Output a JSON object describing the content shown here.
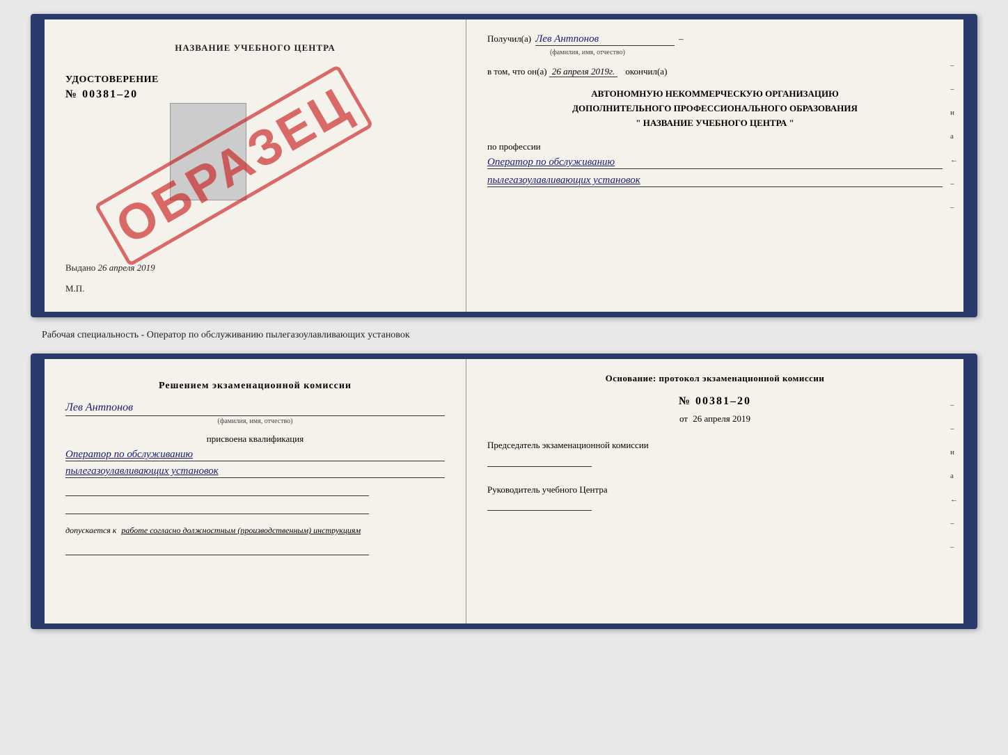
{
  "top_doc": {
    "left": {
      "center_title": "НАЗВАНИЕ УЧЕБНОГО ЦЕНТРА",
      "udostoverenie": "УДОСТОВЕРЕНИЕ",
      "number": "№ 00381–20",
      "vydano_prefix": "Выдано",
      "vydano_date": "26 апреля 2019",
      "mp": "М.П.",
      "obrazec": "ОБРАЗЕЦ"
    },
    "right": {
      "poluchil_prefix": "Получил(а)",
      "recipient_name": "Лев Антпонов",
      "fio_sub": "(фамилия, имя, отчество)",
      "vtom_prefix": "в том, что он(а)",
      "vtom_date": "26 апреля 2019г.",
      "okonchil": "окончил(а)",
      "org_line1": "АВТОНОМНУЮ НЕКОММЕРЧЕСКУЮ ОРГАНИЗАЦИЮ",
      "org_line2": "ДОПОЛНИТЕЛЬНОГО ПРОФЕССИОНАЛЬНОГО ОБРАЗОВАНИЯ",
      "org_line3": "\" НАЗВАНИЕ УЧЕБНОГО ЦЕНТРА \"",
      "po_professii": "по профессии",
      "prof_line1": "Оператор по обслуживанию",
      "prof_line2": "пылегазоулавливающих установок"
    }
  },
  "between_text": "Рабочая специальность - Оператор по обслуживанию пылегазоулавливающих установок",
  "bottom_doc": {
    "left": {
      "commission_title": "Решением экзаменационной комиссии",
      "person_name": "Лев Антпонов",
      "fio_sub": "(фамилия, имя, отчество)",
      "assigned_label": "присвоена квалификация",
      "kvalif_line1": "Оператор по обслуживанию",
      "kvalif_line2": "пылегазоулавливающих установок",
      "dopusk_prefix": "допускается к",
      "dopusk_text": "работе согласно должностным (производственным) инструкциям"
    },
    "right": {
      "osnov_title": "Основание: протокол экзаменационной комиссии",
      "protocol_number": "№ 00381–20",
      "ot_prefix": "от",
      "ot_date": "26 апреля 2019",
      "predsedatel_label": "Председатель экзаменационной комиссии",
      "rukovoditel_label": "Руководитель учебного Центра"
    }
  },
  "side_marks": [
    "–",
    "–",
    "и",
    "а",
    "←",
    "–",
    "–"
  ]
}
